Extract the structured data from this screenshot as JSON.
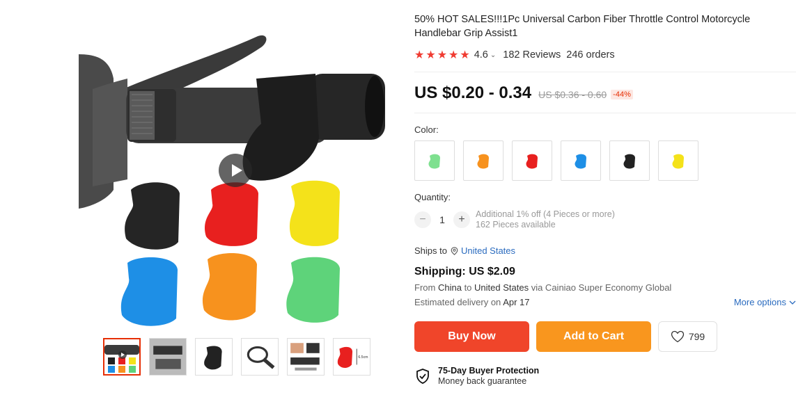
{
  "product": {
    "title": "50% HOT SALES!!!1Pc Universal Carbon Fiber Throttle Control Motorcycle Handlebar Grip Assist1",
    "rating": "4.6",
    "reviews": "182 Reviews",
    "orders": "246 orders",
    "price": "US $0.20 - 0.34",
    "old_price": "US $0.36 - 0.60",
    "discount": "-44%"
  },
  "gallery": {
    "play_icon": "play-icon",
    "thumbnails": [
      "thumb-1",
      "thumb-2",
      "thumb-3",
      "thumb-4",
      "thumb-5",
      "thumb-6"
    ],
    "thumb_caption": "6.5cm"
  },
  "color": {
    "label": "Color:",
    "options": [
      "green",
      "orange",
      "red",
      "blue",
      "black",
      "yellow"
    ],
    "option_colors": [
      "#4fd06a",
      "#f7921e",
      "#e8201f",
      "#1e8fe6",
      "#222222",
      "#f4e21a"
    ]
  },
  "quantity": {
    "label": "Quantity:",
    "value": "1",
    "minus": "−",
    "plus": "+",
    "discount_note": "Additional 1% off (4 Pieces or more)",
    "available": "162 Pieces available"
  },
  "shipping": {
    "ships_to_label": "Ships to",
    "country": "United States",
    "cost": "Shipping: US $2.09",
    "from_label": "From",
    "from": "China",
    "to_label": "to",
    "to": "United States",
    "via": "via Cainiao Super Economy Global",
    "delivery_label": "Estimated delivery on",
    "delivery_date": "Apr 17",
    "more_options": "More options"
  },
  "actions": {
    "buy_now": "Buy Now",
    "add_to_cart": "Add to Cart",
    "wishlist_count": "799"
  },
  "protection": {
    "title": "75-Day Buyer Protection",
    "subtitle": "Money back guarantee"
  },
  "colors": {
    "star": "#f03b31",
    "link": "#2a6bbf",
    "buy_now": "#f0452a",
    "add_to_cart": "#f9961e",
    "discount": "#e62e04"
  }
}
